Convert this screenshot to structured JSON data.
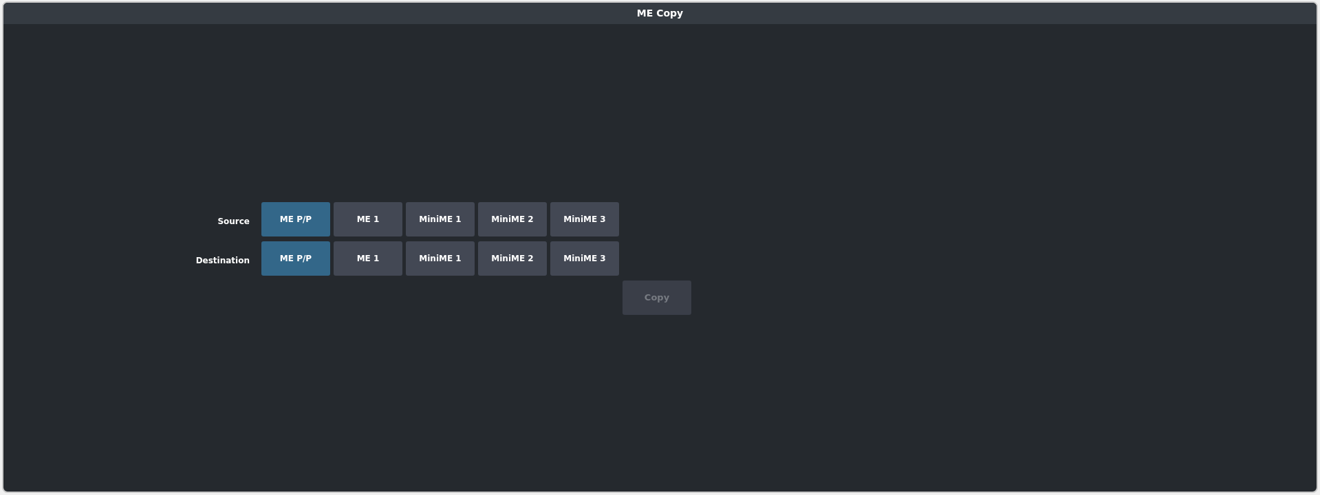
{
  "window": {
    "title": "ME Copy"
  },
  "rows": [
    {
      "label": "Source",
      "options": [
        {
          "label": "ME P/P",
          "selected": true
        },
        {
          "label": "ME 1",
          "selected": false
        },
        {
          "label": "MiniME 1",
          "selected": false
        },
        {
          "label": "MiniME 2",
          "selected": false
        },
        {
          "label": "MiniME 3",
          "selected": false
        }
      ]
    },
    {
      "label": "Destination",
      "options": [
        {
          "label": "ME P/P",
          "selected": true
        },
        {
          "label": "ME 1",
          "selected": false
        },
        {
          "label": "MiniME 1",
          "selected": false
        },
        {
          "label": "MiniME 2",
          "selected": false
        },
        {
          "label": "MiniME 3",
          "selected": false
        }
      ]
    }
  ],
  "copy_button": {
    "label": "Copy",
    "disabled": true
  }
}
